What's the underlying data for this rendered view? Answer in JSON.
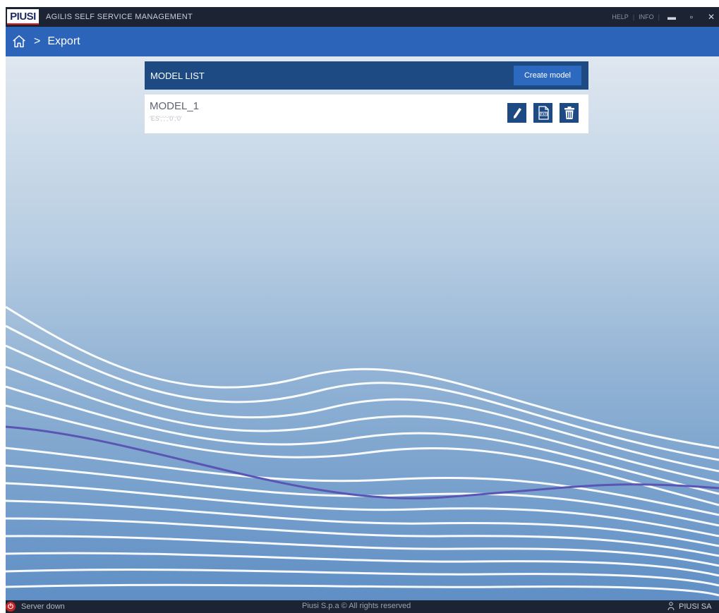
{
  "titlebar": {
    "logo": "PIUSI",
    "app_title": "AGILIS SELF SERVICE MANAGEMENT",
    "help": "HELP",
    "info": "INFO",
    "minimize": "▬",
    "maximize": "▫",
    "close": "✕"
  },
  "breadcrumb": {
    "separator": ">",
    "current": "Export"
  },
  "model_list": {
    "title": "MODEL LIST",
    "create_label": "Create model",
    "items": [
      {
        "name": "MODEL_1",
        "details": "'ES';';';'0';'0'"
      }
    ]
  },
  "footer": {
    "status_text": "Server down",
    "copyright": "Piusi S.p.a © All rights reserved",
    "user": "PIUSI SA"
  },
  "colors": {
    "titlebar": "#1c2433",
    "breadcrumb": "#2c64b9",
    "panel_header": "#1e4a84",
    "action_button": "#1e4a84",
    "status_down": "#c72525"
  }
}
